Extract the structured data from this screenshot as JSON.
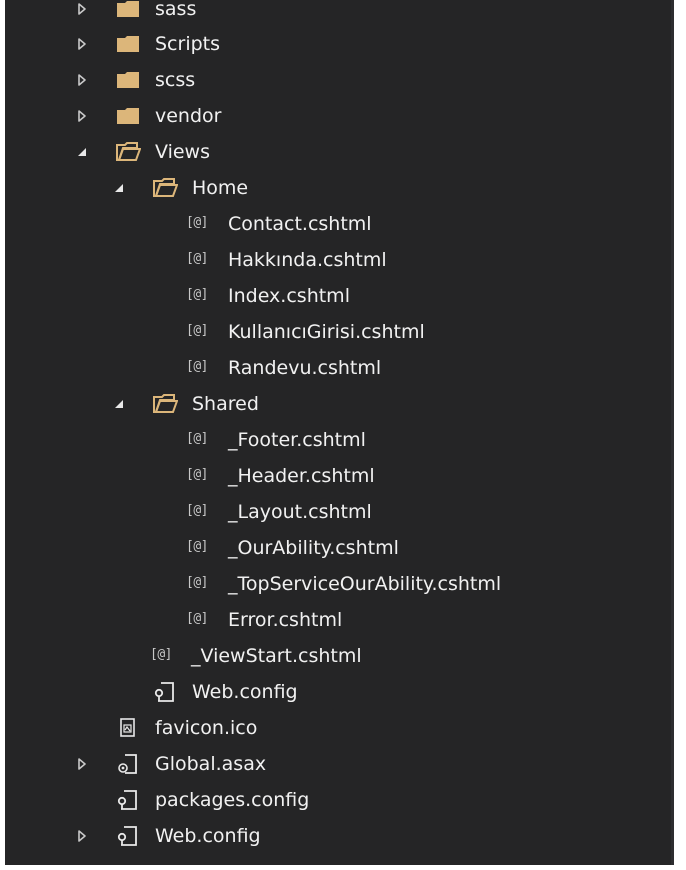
{
  "colors": {
    "panel_background": "#252526",
    "text": "#f1f1f1",
    "folder": "#dcb67a",
    "glyph": "#c8c8c8"
  },
  "razor_glyph": "[@]",
  "tree": [
    {
      "label": "sass",
      "icon": "folder-icon",
      "state": "collapsed"
    },
    {
      "label": "Scripts",
      "icon": "folder-icon",
      "state": "collapsed"
    },
    {
      "label": "scss",
      "icon": "folder-icon",
      "state": "collapsed"
    },
    {
      "label": "vendor",
      "icon": "folder-icon",
      "state": "collapsed"
    },
    {
      "label": "Views",
      "icon": "folder-open-icon",
      "state": "expanded"
    },
    {
      "label": "Home",
      "icon": "folder-open-icon",
      "state": "expanded"
    },
    {
      "label": "Contact.cshtml",
      "icon": "razor-file-icon",
      "state": "none"
    },
    {
      "label": "Hakkında.cshtml",
      "icon": "razor-file-icon",
      "state": "none"
    },
    {
      "label": "Index.cshtml",
      "icon": "razor-file-icon",
      "state": "none"
    },
    {
      "label": "KullanıcıGirisi.cshtml",
      "icon": "razor-file-icon",
      "state": "none"
    },
    {
      "label": "Randevu.cshtml",
      "icon": "razor-file-icon",
      "state": "none"
    },
    {
      "label": "Shared",
      "icon": "folder-open-icon",
      "state": "expanded"
    },
    {
      "label": "_Footer.cshtml",
      "icon": "razor-file-icon",
      "state": "none"
    },
    {
      "label": "_Header.cshtml",
      "icon": "razor-file-icon",
      "state": "none"
    },
    {
      "label": "_Layout.cshtml",
      "icon": "razor-file-icon",
      "state": "none"
    },
    {
      "label": "_OurAbility.cshtml",
      "icon": "razor-file-icon",
      "state": "none"
    },
    {
      "label": "_TopServiceOurAbility.cshtml",
      "icon": "razor-file-icon",
      "state": "none"
    },
    {
      "label": "Error.cshtml",
      "icon": "razor-file-icon",
      "state": "none"
    },
    {
      "label": "_ViewStart.cshtml",
      "icon": "razor-file-icon",
      "state": "none"
    },
    {
      "label": "Web.config",
      "icon": "config-file-icon",
      "state": "none"
    },
    {
      "label": "favicon.ico",
      "icon": "image-file-icon",
      "state": "none"
    },
    {
      "label": "Global.asax",
      "icon": "asax-file-icon",
      "state": "collapsed"
    },
    {
      "label": "packages.config",
      "icon": "config-file-icon",
      "state": "none"
    },
    {
      "label": "Web.config",
      "icon": "config-file-icon",
      "state": "collapsed"
    }
  ]
}
